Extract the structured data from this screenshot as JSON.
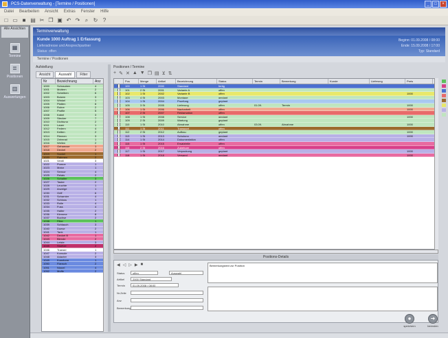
{
  "window": {
    "title": "PCS-Datenverwaltung - [Termine / Positionen]",
    "buttons": [
      "_",
      "□",
      "×"
    ]
  },
  "menu": [
    "Datei",
    "Bearbeiten",
    "Ansicht",
    "Extras",
    "Fenster",
    "Hilfe"
  ],
  "nav": {
    "header": "Alle Ansichten",
    "items": [
      {
        "label": "Termine",
        "icon": "calendar-icon"
      },
      {
        "label": "Positionen",
        "icon": "list-icon"
      },
      {
        "label": "Auswertungen",
        "icon": "chart-icon"
      }
    ]
  },
  "main": {
    "header": "Terminverwaltung",
    "info": {
      "title": "Kunde 1000 Auftrag 1 Erfassung",
      "line2": "Lieferadresse und Ansprechpartner",
      "line3": "Status: offen",
      "right1": "Beginn: 01.09.2008 / 08:00",
      "right2": "Ende: 15.09.2008 / 17:00",
      "right3": "Typ: Standard"
    },
    "path": "Termine / Positionen"
  },
  "left": {
    "title": "Aufstellung",
    "tabs": [
      "Ansicht",
      "Auswahl",
      "Filter"
    ],
    "columns": [
      "Nr",
      "Bezeichnung",
      "Anz"
    ],
    "rows": [
      {
        "nr": "1000",
        "name": "Schrauben",
        "n": "4",
        "color": "#bfe5bf"
      },
      {
        "nr": "1001",
        "name": "Muttern",
        "n": "2",
        "color": "#bfe5bf"
      },
      {
        "nr": "1002",
        "name": "Scheiben",
        "n": "6",
        "color": "#bfe5bf"
      },
      {
        "nr": "1003",
        "name": "Bolzen",
        "n": "3",
        "color": "#bfe5bf"
      },
      {
        "nr": "1004",
        "name": "Winkel",
        "n": "1",
        "color": "#bfe5bf"
      },
      {
        "nr": "1005",
        "name": "Platten",
        "n": "8",
        "color": "#bfe5bf"
      },
      {
        "nr": "1006",
        "name": "Rohre",
        "n": "2",
        "color": "#bfe5bf"
      },
      {
        "nr": "1007",
        "name": "Profile",
        "n": "5",
        "color": "#bfe5bf"
      },
      {
        "nr": "1008",
        "name": "Kabel",
        "n": "3",
        "color": "#bfe5bf"
      },
      {
        "nr": "1009",
        "name": "Stecker",
        "n": "7",
        "color": "#bfe5bf"
      },
      {
        "nr": "1010",
        "name": "Dichtung",
        "n": "2",
        "color": "#bfe5bf"
      },
      {
        "nr": "1011",
        "name": "Lager",
        "n": "1",
        "color": "#bfe5bf"
      },
      {
        "nr": "1012",
        "name": "Federn",
        "n": "4",
        "color": "#bfe5bf"
      },
      {
        "nr": "1013",
        "name": "Ketten",
        "n": "2",
        "color": "#bfe5bf"
      },
      {
        "nr": "1014",
        "name": "Riemen",
        "n": "3",
        "color": "#bfe5bf"
      },
      {
        "nr": "1015",
        "name": "Zahnrad",
        "n": "1",
        "color": "#bfe5bf"
      },
      {
        "nr": "1016",
        "name": "Wellen",
        "n": "2",
        "color": "#bfe5bf"
      },
      {
        "nr": "1017",
        "name": "Gehaeuse",
        "n": "1",
        "color": "#f0a890"
      },
      {
        "nr": "1018",
        "name": "Deckel",
        "n": "2",
        "color": "#f0a890"
      },
      {
        "nr": "1019",
        "name": "Sockel",
        "n": "1",
        "color": "#9c6a2e"
      },
      {
        "nr": "1020",
        "name": "Rahmen",
        "n": "2",
        "color": "#9c6a2e"
      },
      {
        "nr": "1021",
        "name": "Ventil",
        "n": "3",
        "color": "#ffffff"
      },
      {
        "nr": "1022",
        "name": "Pumpe",
        "n": "1",
        "color": "#b8b0e6"
      },
      {
        "nr": "1023",
        "name": "Motor",
        "n": "1",
        "color": "#b8b0e6"
      },
      {
        "nr": "1024",
        "name": "Sensor",
        "n": "4",
        "color": "#b8b0e6"
      },
      {
        "nr": "1025",
        "name": "Relais",
        "n": "2",
        "color": "#b8b0e6"
      },
      {
        "nr": "1026",
        "name": "Schalter",
        "n": "3",
        "color": "#5cc25c"
      },
      {
        "nr": "1027",
        "name": "Taster",
        "n": "2",
        "color": "#b8b0e6"
      },
      {
        "nr": "1028",
        "name": "Leuchte",
        "n": "1",
        "color": "#b8b0e6"
      },
      {
        "nr": "1029",
        "name": "Anzeige",
        "n": "1",
        "color": "#b8b0e6"
      },
      {
        "nr": "1030",
        "name": "Griff",
        "n": "6",
        "color": "#b8b0e6"
      },
      {
        "nr": "1031",
        "name": "Scharnier",
        "n": "4",
        "color": "#b8b0e6"
      },
      {
        "nr": "1032",
        "name": "Schloss",
        "n": "1",
        "color": "#b8b0e6"
      },
      {
        "nr": "1033",
        "name": "Rolle",
        "n": "4",
        "color": "#b8b0e6"
      },
      {
        "nr": "1034",
        "name": "Fuss",
        "n": "4",
        "color": "#b8b0e6"
      },
      {
        "nr": "1035",
        "name": "Halter",
        "n": "2",
        "color": "#b8b0e6"
      },
      {
        "nr": "1036",
        "name": "Klemme",
        "n": "8",
        "color": "#b8b0e6"
      },
      {
        "nr": "1037",
        "name": "Buchse",
        "n": "2",
        "color": "#b8b0e6"
      },
      {
        "nr": "1038",
        "name": "Filter",
        "n": "1",
        "color": "#5cc25c"
      },
      {
        "nr": "1039",
        "name": "Schlauch",
        "n": "3",
        "color": "#b8b0e6"
      },
      {
        "nr": "1040",
        "name": "Duese",
        "n": "2",
        "color": "#b8b0e6"
      },
      {
        "nr": "1041",
        "name": "Tank",
        "n": "1",
        "color": "#b8b0e6"
      },
      {
        "nr": "1042",
        "name": "Deckel B",
        "n": "1",
        "color": "#e86aa0"
      },
      {
        "nr": "1043",
        "name": "Blende",
        "n": "2",
        "color": "#e86aa0"
      },
      {
        "nr": "1044",
        "name": "Leiste",
        "n": "3",
        "color": "#b8b0e6"
      },
      {
        "nr": "1045",
        "name": "Stuetze",
        "n": "2",
        "color": "#c0306a"
      },
      {
        "nr": "1046",
        "name": "Traeger",
        "n": "1",
        "color": "#ffffff"
      },
      {
        "nr": "1047",
        "name": "Konsole",
        "n": "2",
        "color": "#b8b0e6"
      },
      {
        "nr": "1048",
        "name": "Adapter",
        "n": "3",
        "color": "#b8b0e6"
      },
      {
        "nr": "1049",
        "name": "Kupplung",
        "n": "1",
        "color": "#6a8ae0"
      },
      {
        "nr": "1050",
        "name": "Flansch",
        "n": "2",
        "color": "#6a8ae0"
      },
      {
        "nr": "1051",
        "name": "Nippel",
        "n": "4",
        "color": "#6a8ae0"
      },
      {
        "nr": "1052",
        "name": "Muffe",
        "n": "2",
        "color": "#6a8ae0"
      }
    ]
  },
  "grid": {
    "title": "Positionen / Termine",
    "columns": [
      "",
      "Pos",
      "Menge",
      "Artikel",
      "Bezeichnung",
      "Status",
      "Termin",
      "Bemerkung",
      "Kunde",
      "Lieferung",
      "Preis"
    ],
    "rows": [
      {
        "pos": "100",
        "menge": "1 St",
        "art": "2000",
        "bez": "Standard",
        "status": "fertig",
        "termin": "",
        "bem": "",
        "kunde": "",
        "lief": "",
        "preis": "",
        "color": "#4a6fd0"
      },
      {
        "pos": "101",
        "menge": "2 St",
        "art": "2001",
        "bez": "Variante A",
        "status": "offen",
        "termin": "",
        "bem": "",
        "kunde": "",
        "lief": "",
        "preis": "",
        "color": "#bfe5bf"
      },
      {
        "pos": "102",
        "menge": "1 St",
        "art": "2002",
        "bez": "Variante B",
        "status": "offen",
        "termin": "",
        "bem": "",
        "kunde": "",
        "lief": "",
        "preis": "1000",
        "color": "#e8e86a"
      },
      {
        "pos": "103",
        "menge": "4 St",
        "art": "2003",
        "bez": "Montage",
        "status": "geplant",
        "termin": "",
        "bem": "",
        "kunde": "",
        "lief": "",
        "preis": "",
        "color": "#bfe5bf"
      },
      {
        "pos": "104",
        "menge": "1 St",
        "art": "2004",
        "bez": "Pruefung",
        "status": "geplant",
        "termin": "",
        "bem": "",
        "kunde": "",
        "lief": "",
        "preis": "",
        "color": "#a8c8f0"
      },
      {
        "pos": "105",
        "menge": "3 St",
        "art": "2005",
        "bez": "Lieferung",
        "status": "offen",
        "termin": "01.09.",
        "bem": "Termin",
        "kunde": "",
        "lief": "",
        "preis": "1000",
        "color": "#bfe5bf"
      },
      {
        "pos": "106",
        "menge": "1 St",
        "art": "2006",
        "bez": "Nacharbeit",
        "status": "offen",
        "termin": "",
        "bem": "",
        "kunde": "",
        "lief": "",
        "preis": "1000",
        "color": "#f0a890"
      },
      {
        "pos": "107",
        "menge": "2 St",
        "art": "2007",
        "bez": "Reklamation",
        "status": "offen",
        "termin": "",
        "bem": "",
        "kunde": "",
        "lief": "",
        "preis": "",
        "color": "#e86a6a"
      },
      {
        "pos": "108",
        "menge": "1 St",
        "art": "2008",
        "bez": "Service",
        "status": "geplant",
        "termin": "",
        "bem": "",
        "kunde": "",
        "lief": "",
        "preis": "1000",
        "color": "#bfe5bf"
      },
      {
        "pos": "109",
        "menge": "2 St",
        "art": "2009",
        "bez": "Wartung",
        "status": "geplant",
        "termin": "",
        "bem": "",
        "kunde": "",
        "lief": "",
        "preis": "",
        "color": "#bfe5bf"
      },
      {
        "pos": "110",
        "menge": "1 St",
        "art": "2010",
        "bez": "Abnahme",
        "status": "offen",
        "termin": "03.09.",
        "bem": "Abnahme",
        "kunde": "",
        "lief": "",
        "preis": "1000",
        "color": "#bfe5bf"
      },
      {
        "pos": "111",
        "menge": "1 St",
        "art": "2011",
        "bez": "Transport",
        "status": "offen",
        "termin": "",
        "bem": "",
        "kunde": "",
        "lief": "",
        "preis": "",
        "color": "#9c6a2e"
      },
      {
        "pos": "112",
        "menge": "2 St",
        "art": "2012",
        "bez": "Aufbau",
        "status": "geplant",
        "termin": "",
        "bem": "",
        "kunde": "",
        "lief": "",
        "preis": "1000",
        "color": "#bfe5bf"
      },
      {
        "pos": "113",
        "menge": "1 St",
        "art": "2013",
        "bez": "Schulung",
        "status": "geplant",
        "termin": "",
        "bem": "",
        "kunde": "",
        "lief": "",
        "preis": "1000",
        "color": "#b8b0e6"
      },
      {
        "pos": "114",
        "menge": "1 St",
        "art": "2014",
        "bez": "Dokumentation",
        "status": "offen",
        "termin": "",
        "bem": "",
        "kunde": "",
        "lief": "",
        "preis": "",
        "color": "#b8b0e6"
      },
      {
        "pos": "115",
        "menge": "1 St",
        "art": "2015",
        "bez": "Ersatzteile",
        "status": "offen",
        "termin": "",
        "bem": "",
        "kunde": "",
        "lief": "",
        "preis": "",
        "color": "#e86aa0"
      },
      {
        "pos": "116",
        "menge": "2 St",
        "art": "2016",
        "bez": "Zubehoer",
        "status": "offen",
        "termin": "",
        "bem": "",
        "kunde": "",
        "lief": "",
        "preis": "",
        "color": "#d8408a"
      },
      {
        "pos": "117",
        "menge": "1 St",
        "art": "2017",
        "bez": "Verpackung",
        "status": "geplant",
        "termin": "",
        "bem": "",
        "kunde": "",
        "lief": "",
        "preis": "1000",
        "color": "#b8b0e6"
      },
      {
        "pos": "118",
        "menge": "1 St",
        "art": "2018",
        "bez": "Versand",
        "status": "geplant",
        "termin": "",
        "bem": "",
        "kunde": "",
        "lief": "",
        "preis": "1000",
        "color": "#e86aa0"
      }
    ]
  },
  "detail": {
    "title": "Positions-Details",
    "labels": {
      "status": "Status",
      "artikel": "Artikel",
      "termin": "Termin",
      "nr": "Nr.Zeile",
      "anz": "Anz",
      "bemerkung": "Bemerkung"
    },
    "values": {
      "status": "offen",
      "artikel": "2000 Standard",
      "termin": "01.09.2008 / 08:00",
      "combo": "Auswahl"
    },
    "memo": "Bemerkungstext zur Position"
  },
  "buttons": [
    {
      "label": "speichern",
      "icon": "save-icon"
    },
    {
      "label": "beenden",
      "icon": "exit-icon"
    }
  ],
  "right_strip_colors": [
    "#5cc25c",
    "#d8408a",
    "#4a6fd0",
    "#e86a6a",
    "#9c6a2e",
    "#e8e86a",
    "#b8b0e6",
    "#bfe5bf"
  ]
}
